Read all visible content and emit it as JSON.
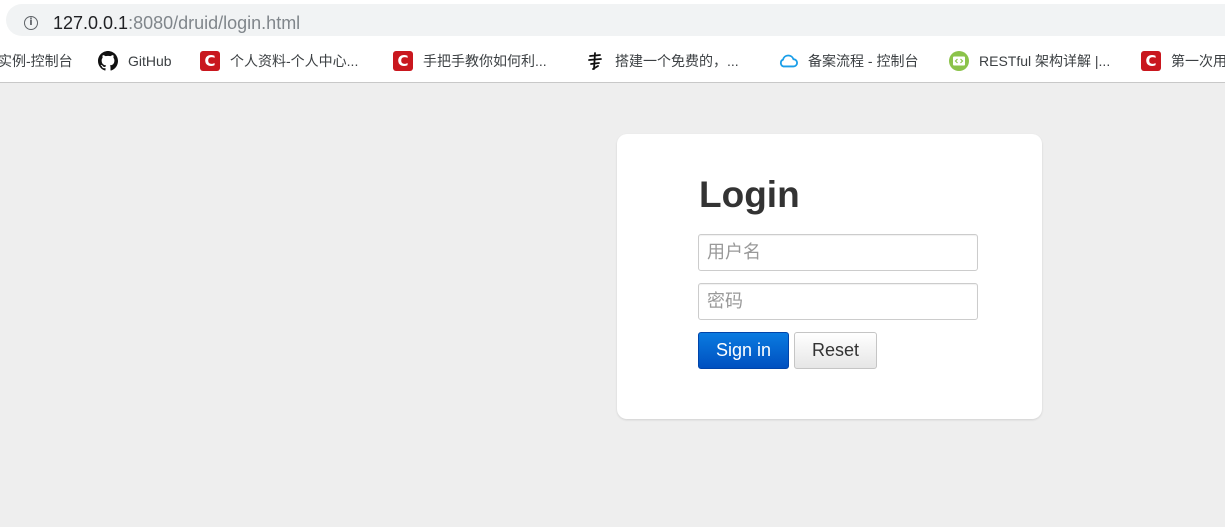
{
  "browser": {
    "url_host": "127.0.0.1",
    "url_rest": ":8080/druid/login.html"
  },
  "bookmarks": [
    {
      "label": "实例-控制台",
      "icon": "none"
    },
    {
      "label": "GitHub",
      "icon": "github-icon"
    },
    {
      "label": "个人资料-个人中心...",
      "icon": "csdn-icon"
    },
    {
      "label": "手把手教你如何利...",
      "icon": "csdn-icon"
    },
    {
      "label": "搭建一个免费的，...",
      "icon": "shu-icon"
    },
    {
      "label": "备案流程 - 控制台",
      "icon": "cloud-icon"
    },
    {
      "label": "RESTful 架构详解 |...",
      "icon": "code-icon"
    },
    {
      "label": "第一次用",
      "icon": "csdn-icon"
    }
  ],
  "login": {
    "title": "Login",
    "username_placeholder": "用户名",
    "password_placeholder": "密码",
    "signin_label": "Sign in",
    "reset_label": "Reset"
  },
  "colors": {
    "page_bg": "#eeeeee",
    "card_bg": "#ffffff",
    "primary": "#0a6fd8",
    "csdn_red": "#c9171e"
  }
}
